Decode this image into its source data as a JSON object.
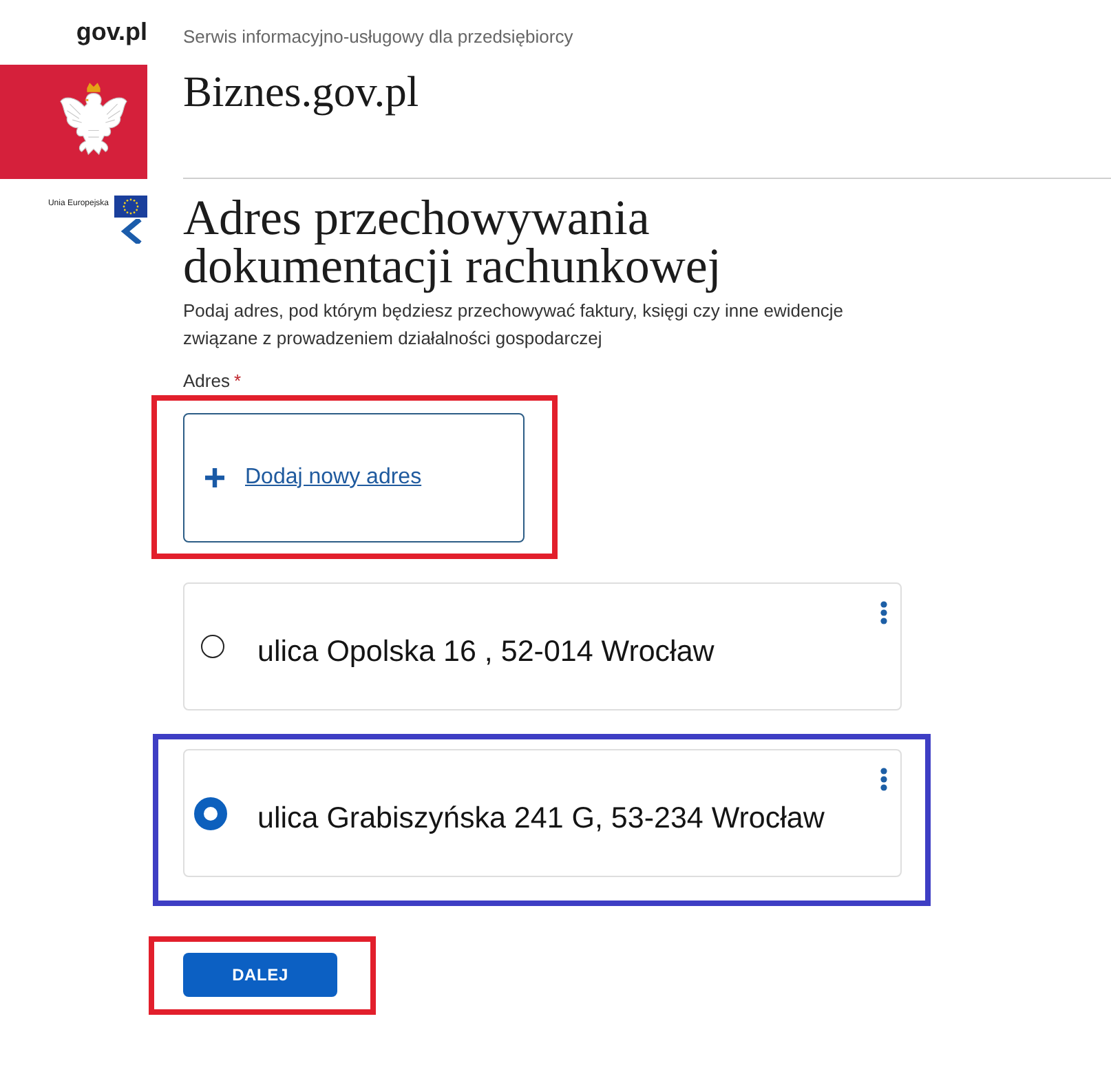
{
  "header": {
    "logo_text": "gov.pl",
    "tagline": "Serwis informacyjno-usługowy dla przedsiębiorcy",
    "site_title": "Biznes.gov.pl"
  },
  "eu_mark": {
    "label": "Unia Europejska"
  },
  "form": {
    "title": "Adres przechowywania dokumentacji rachunkowej",
    "description": "Podaj adres, pod którym będziesz przechowywać faktury, księgi czy inne ewidencje związane z prowadzeniem działalności gospodarczej",
    "field_label": "Adres",
    "required_mark": "*",
    "add_address": {
      "label": "Dodaj nowy adres",
      "highlight": {
        "color": "#e21f2c"
      }
    },
    "addresses": [
      {
        "text": "ulica Opolska 16 , 52-014 Wrocław",
        "selected": false
      },
      {
        "text": "ulica Grabiszyńska 241 G, 53-234 Wrocław",
        "selected": true,
        "highlight": {
          "color": "#3e3ec4"
        }
      }
    ],
    "next_button": {
      "label": "DALEJ",
      "highlight": {
        "color": "#e21f2c"
      }
    }
  }
}
